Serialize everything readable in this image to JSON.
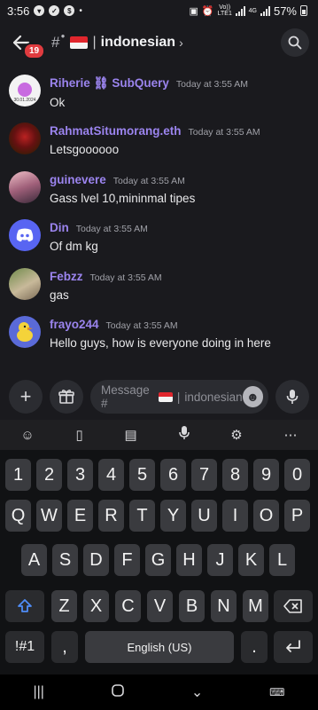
{
  "status_bar": {
    "time": "3:56",
    "network_label": "Vo)) LTE1",
    "network_gen": "4G",
    "battery": "57%"
  },
  "header": {
    "back_icon": "back-arrow-icon",
    "unread_badge": "19",
    "channel_prefix": "#",
    "separator": "|",
    "channel_name": "indonesian",
    "chevron": "›",
    "search_icon": "search-icon"
  },
  "messages": [
    {
      "username": "Riherie ⛓ SubQuery",
      "timestamp": "Today at 3:55 AM",
      "text": "Ok",
      "avatar_caption": "30.01.2024"
    },
    {
      "username": "RahmatSitumorang.eth",
      "timestamp": "Today at 3:55 AM",
      "text": "Letsgoooooo"
    },
    {
      "username": "guinevere",
      "timestamp": "Today at 3:55 AM",
      "text": "Gass lvel 10,mininmal tipes"
    },
    {
      "username": "Din",
      "timestamp": "Today at 3:55 AM",
      "text": "Of dm kg"
    },
    {
      "username": "Febzz",
      "timestamp": "Today at 3:55 AM",
      "text": "gas"
    },
    {
      "username": "frayo244",
      "timestamp": "Today at 3:55 AM",
      "text": "Hello guys,  how is everyone doing in here"
    }
  ],
  "composer": {
    "placeholder_prefix": "Message #",
    "placeholder_sep": "|",
    "placeholder_channel": "indonesian"
  },
  "keyboard": {
    "row_numbers": [
      "1",
      "2",
      "3",
      "4",
      "5",
      "6",
      "7",
      "8",
      "9",
      "0"
    ],
    "row_top": [
      "Q",
      "W",
      "E",
      "R",
      "T",
      "Y",
      "U",
      "I",
      "O",
      "P"
    ],
    "row_middle": [
      "A",
      "S",
      "D",
      "F",
      "G",
      "H",
      "J",
      "K",
      "L"
    ],
    "row_bottom": [
      "Z",
      "X",
      "C",
      "V",
      "B",
      "N",
      "M"
    ],
    "symbols_key": "!#1",
    "comma_key": ",",
    "space_label": "English (US)",
    "period_key": "."
  },
  "colors": {
    "username": "#9b84ee",
    "background": "#1a1a1e",
    "badge": "#e03b3f"
  }
}
